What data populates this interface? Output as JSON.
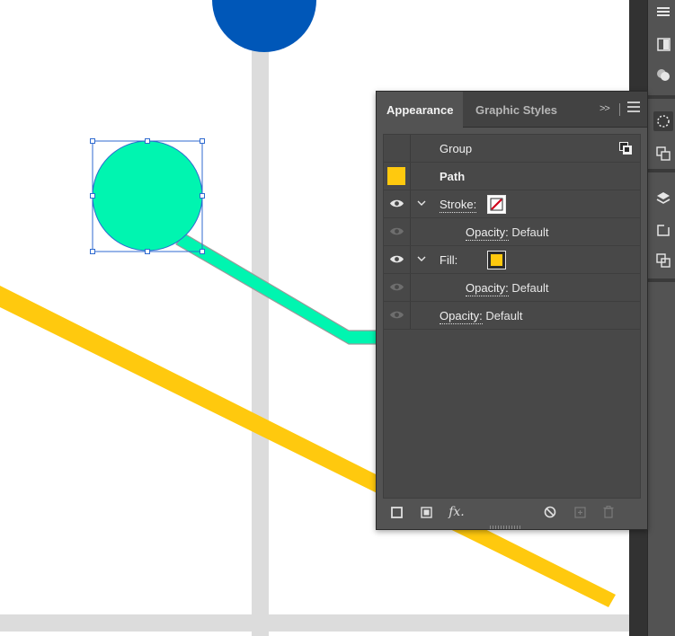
{
  "panel": {
    "tabs": [
      {
        "label": "Appearance",
        "active": true
      },
      {
        "label": "Graphic Styles",
        "active": false
      }
    ],
    "collapse_glyph": ">>",
    "rows": {
      "group": {
        "label": "Group"
      },
      "path": {
        "label": "Path",
        "swatch_color": "#ffc90e"
      },
      "stroke": {
        "label": "Stroke:"
      },
      "stroke_opacity": {
        "label": "Opacity:",
        "value": "Default"
      },
      "fill": {
        "label": "Fill:",
        "swatch_color": "#ffc90e"
      },
      "fill_opacity": {
        "label": "Opacity:",
        "value": "Default"
      },
      "opacity": {
        "label": "Opacity:",
        "value": "Default"
      }
    },
    "footer": {
      "fx_label": "fx."
    }
  },
  "canvas": {
    "colors": {
      "guide": "#dcdcdc",
      "yellow_line": "#ffc90e",
      "green": "#00f5b0",
      "blue": "#0057b8",
      "selection": "#2f6ad0"
    }
  }
}
